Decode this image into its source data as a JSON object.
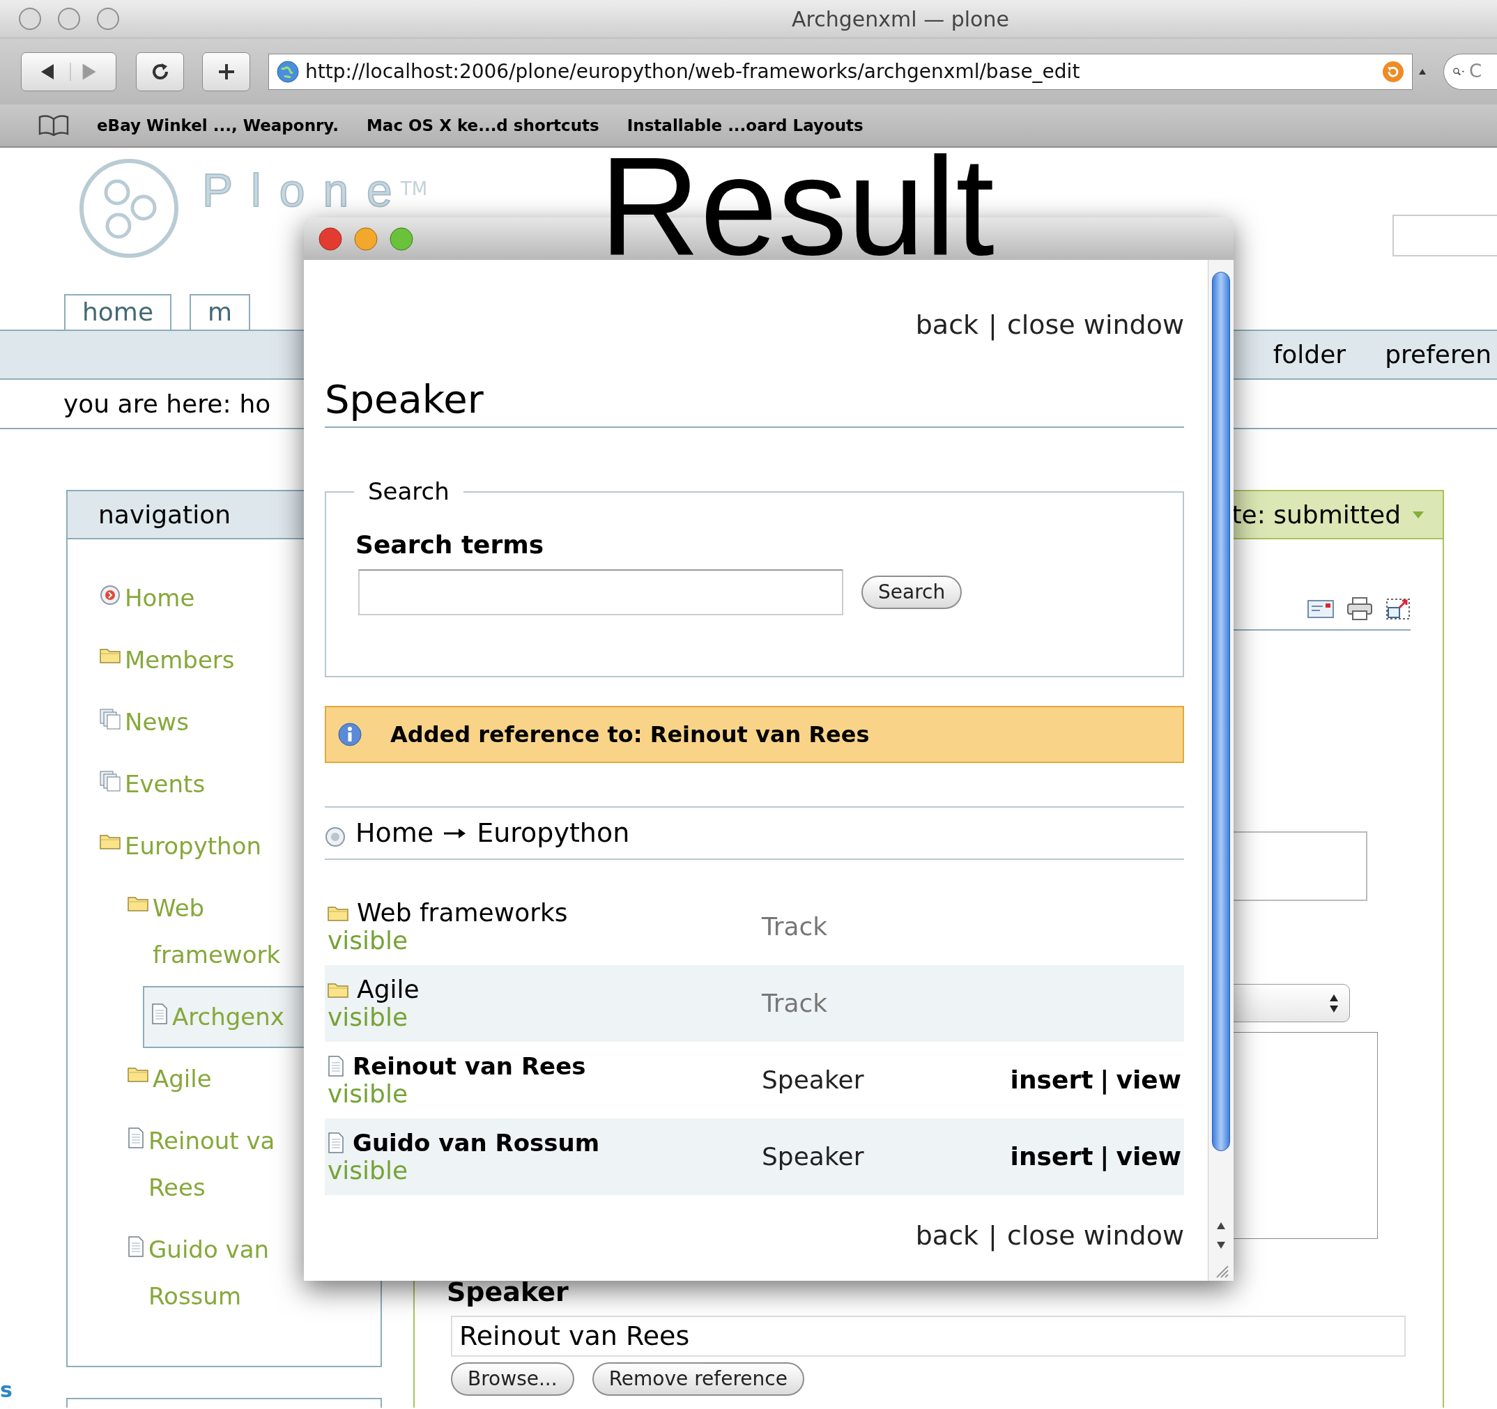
{
  "browser": {
    "title": "Archgenxml — plone",
    "url": "http://localhost:2006/plone/europython/web-frameworks/archgenxml/base_edit",
    "search_placeholder": "C",
    "bookmarks": [
      "eBay Winkel ..., Weaponry.",
      "Mac OS X ke...d shortcuts",
      "Installable ...oard Layouts"
    ]
  },
  "caption": "Result",
  "site": {
    "logo": "Plone",
    "logo_mark": "TM",
    "tabs": [
      {
        "label": "home",
        "selected": false
      },
      {
        "label": "m",
        "selected": false
      }
    ],
    "nav_bar": [
      "folder",
      "preferen"
    ],
    "breadcrumb": {
      "label": "you are here:",
      "link": "ho"
    },
    "navigation": {
      "title": "navigation",
      "items": [
        {
          "label": "Home",
          "kind": "home",
          "selected": false
        },
        {
          "label": "Members",
          "kind": "folder",
          "selected": false
        },
        {
          "label": "News",
          "kind": "collection",
          "selected": false
        },
        {
          "label": "Events",
          "kind": "collection",
          "selected": false
        },
        {
          "label": "Europython",
          "kind": "folder",
          "selected": false,
          "children": [
            {
              "label": "Web framework",
              "kind": "folder",
              "selected": false,
              "children": [
                {
                  "label": "Archgenx",
                  "kind": "document",
                  "selected": true
                }
              ]
            },
            {
              "label": "Agile",
              "kind": "folder",
              "selected": false
            },
            {
              "label": "Reinout va Rees",
              "kind": "document",
              "selected": false
            },
            {
              "label": "Guido van Rossum",
              "kind": "document",
              "selected": false
            }
          ]
        }
      ]
    },
    "edge_text": "s",
    "content": {
      "state_menu": "te: submitted",
      "field_label": "Speaker",
      "field_value": "Reinout van Rees",
      "buttons": [
        "Browse...",
        "Remove reference"
      ]
    }
  },
  "popup": {
    "top_links": [
      "back",
      "close window"
    ],
    "link_separator": "|",
    "heading": "Speaker",
    "search": {
      "legend": "Search",
      "label": "Search terms",
      "button": "Search"
    },
    "message": "Added reference to: Reinout van Rees",
    "breadcrumbs": [
      "Home",
      "Europython"
    ],
    "rows": [
      {
        "title": "Web frameworks",
        "kind": "folder",
        "linked": true,
        "status": "visible",
        "type": "Track"
      },
      {
        "title": "Agile",
        "kind": "folder",
        "linked": true,
        "status": "visible",
        "type": "Track"
      },
      {
        "title": "Reinout van Rees",
        "kind": "document",
        "linked": false,
        "status": "visible",
        "type": "Speaker",
        "actions": [
          "insert",
          "view"
        ]
      },
      {
        "title": "Guido van Rossum",
        "kind": "document",
        "linked": false,
        "status": "visible",
        "type": "Speaker",
        "actions": [
          "insert",
          "view"
        ]
      }
    ],
    "bottom_links": [
      "back",
      "close window"
    ]
  }
}
